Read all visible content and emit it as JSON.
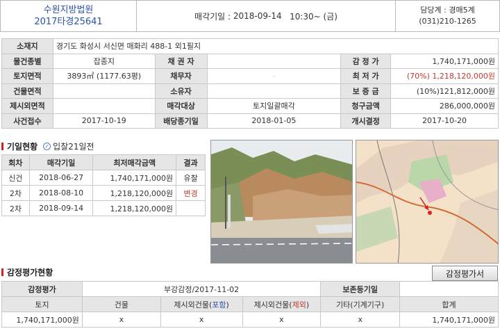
{
  "header": {
    "court": "수원지방법원",
    "case_no": "2017타경25641",
    "sale_label": "매각기일 : ",
    "sale_date": "2018-09-14",
    "sale_time": "10:30~ (금)",
    "dept_label": "담당계 : ",
    "dept": "경매5계",
    "phone": "(031)210-1265"
  },
  "info": {
    "address_label": "소재지",
    "address": "경기도 화성시 서신면 매화리 488-1 외1필지",
    "rows": [
      [
        "물건종별",
        "잡종지",
        "채 권 자",
        "",
        "감 정 가",
        "1,740,171,000원"
      ],
      [
        "토지면적",
        "3893㎡ (1177.63평)",
        "채무자",
        "-",
        "최 저 가",
        "(70%) 1,218,120,000원"
      ],
      [
        "건물면적",
        "",
        "소유자",
        "",
        "보 증 금",
        "(10%)121,812,000원"
      ],
      [
        "제시외면적",
        "",
        "매각대상",
        "토지일괄매각",
        "청구금액",
        "286,000,000원"
      ],
      [
        "사건접수",
        "2017-10-19",
        "배당종기일",
        "2018-01-05",
        "개시결정",
        "2017-10-20"
      ]
    ]
  },
  "history": {
    "title": "기일현황",
    "note": "입찰21일전",
    "headers": [
      "회차",
      "매각기일",
      "최저매각금액",
      "결과"
    ],
    "rows": [
      [
        "신건",
        "2018-06-27",
        "1,740,171,000원",
        "유찰"
      ],
      [
        "2차",
        "2018-08-10",
        "1,218,120,000원",
        "변경"
      ],
      [
        "2차",
        "2018-09-14",
        "1,218,120,000원",
        ""
      ]
    ]
  },
  "appraisal": {
    "title": "감정평가현황",
    "button": "감정평가서",
    "row1": [
      "감정평가",
      "부강감정/2017-11-02",
      "보존등기일",
      ""
    ],
    "headers": [
      "토지",
      "건물",
      "제시외건물(",
      "포함",
      ")",
      "제시외건물(",
      "제외",
      ")",
      "기타(기계기구)",
      "합계"
    ],
    "values": [
      "1,740,171,000원",
      "x",
      "x",
      "x",
      "x",
      "1,740,171,000원"
    ]
  },
  "colors": {
    "accent_blue": "#2a52a8",
    "accent_red": "#c0392b",
    "label_bg": "#e6e6e6"
  },
  "icons": {
    "note_icon": "check-circle-icon"
  }
}
